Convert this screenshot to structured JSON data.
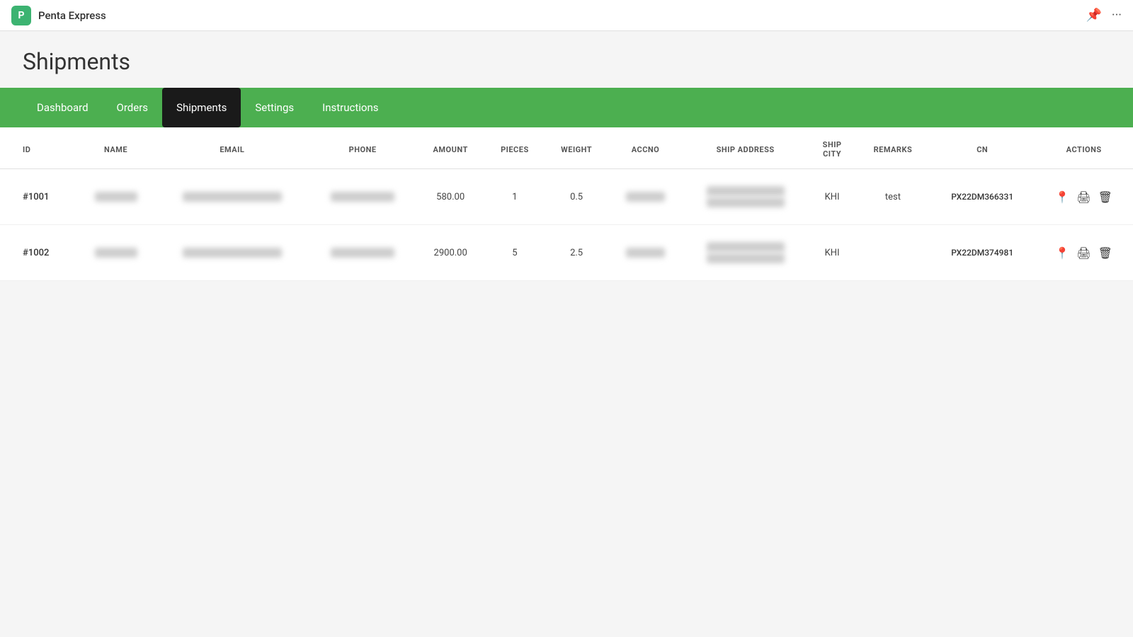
{
  "app": {
    "icon_label": "P",
    "title": "Penta Express",
    "icon_bg": "#3cb371"
  },
  "topbar": {
    "pin_icon": "📌",
    "more_icon": "···"
  },
  "page": {
    "title": "Shipments"
  },
  "nav": {
    "items": [
      {
        "label": "Dashboard",
        "active": false
      },
      {
        "label": "Orders",
        "active": false
      },
      {
        "label": "Shipments",
        "active": true
      },
      {
        "label": "Settings",
        "active": false
      },
      {
        "label": "Instructions",
        "active": false
      }
    ]
  },
  "table": {
    "columns": [
      {
        "key": "id",
        "label": "ID"
      },
      {
        "key": "name",
        "label": "NAME"
      },
      {
        "key": "email",
        "label": "EMAIL"
      },
      {
        "key": "phone",
        "label": "PHONE"
      },
      {
        "key": "amount",
        "label": "AMOUNT"
      },
      {
        "key": "pieces",
        "label": "PIECES"
      },
      {
        "key": "weight",
        "label": "WEIGHT"
      },
      {
        "key": "accno",
        "label": "ACCNO"
      },
      {
        "key": "ship_address",
        "label": "SHIP ADDRESS"
      },
      {
        "key": "ship_city",
        "label": "SHIP CITY"
      },
      {
        "key": "remarks",
        "label": "REMARKS"
      },
      {
        "key": "cn",
        "label": "CN"
      },
      {
        "key": "actions",
        "label": "ACTIONS"
      }
    ],
    "rows": [
      {
        "id": "#1001",
        "name": "████",
        "email": "████████████████",
        "phone": "█████████",
        "amount": "580.00",
        "pieces": "1",
        "weight": "0.5",
        "accno": "█████",
        "ship_address_line1": "██████████",
        "ship_address_line2": "██████████",
        "ship_city": "KHI",
        "remarks": "test",
        "cn": "PX22DM366331"
      },
      {
        "id": "#1002",
        "name": "████",
        "email": "████████████████",
        "phone": "█████████",
        "amount": "2900.00",
        "pieces": "5",
        "weight": "2.5",
        "accno": "█████",
        "ship_address_line1": "██████████",
        "ship_address_line2": "██████████",
        "ship_city": "KHI",
        "remarks": "",
        "cn": "PX22DM374981"
      }
    ]
  }
}
